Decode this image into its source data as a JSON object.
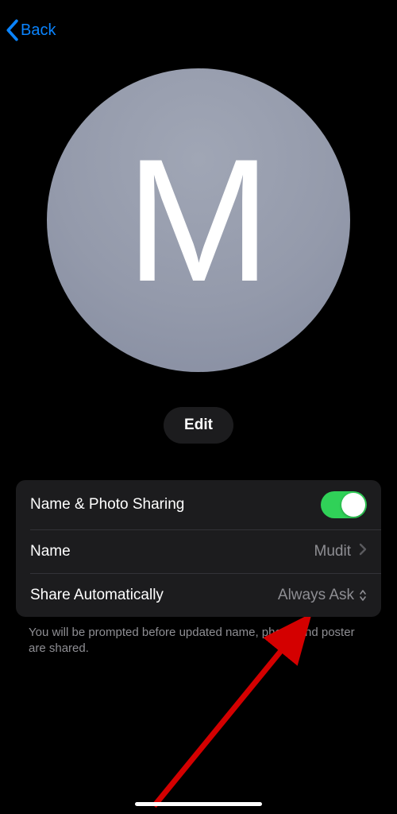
{
  "nav": {
    "back_label": "Back"
  },
  "avatar": {
    "initial": "M"
  },
  "edit": {
    "label": "Edit"
  },
  "settings": {
    "sharing": {
      "label": "Name & Photo Sharing",
      "enabled": true
    },
    "name": {
      "label": "Name",
      "value": "Mudit"
    },
    "share_auto": {
      "label": "Share Automatically",
      "value": "Always Ask"
    }
  },
  "footer": {
    "text": "You will be prompted before updated name, photo, and poster are shared."
  }
}
